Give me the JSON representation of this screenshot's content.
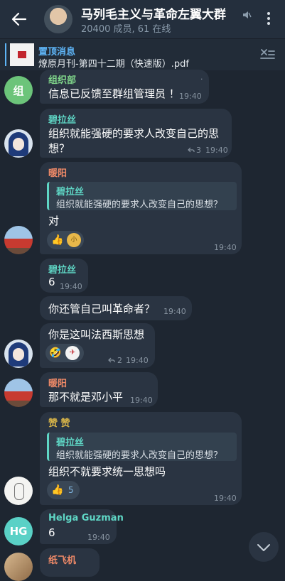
{
  "header": {
    "title": "马列毛主义与革命左翼大群",
    "subtitle": "20400 成员, 61 在线"
  },
  "pinned": {
    "title": "置顶消息",
    "text": "燎原月刊-第四十二期（快速版）.pdf"
  },
  "colors": {
    "accent": "#5eb5f7",
    "name_teal": "#5fd6c5",
    "name_orange": "#f08a68",
    "name_yellow": "#d6b349",
    "name_green": "#7fd48a"
  },
  "messages": [
    {
      "sender": "组织部",
      "avatar_text": "组",
      "text": "信息已反馈至群组管理员 ！",
      "time": "19:40",
      "mark": "."
    },
    {
      "sender": "碧拉丝",
      "lines": [
        "组织就能强硬的要求人改变自己的思",
        "想？"
      ],
      "time": "19:40",
      "replies": "3"
    },
    {
      "sender": "暖阳",
      "reply_name": "碧拉丝",
      "reply_text": "组织就能强硬的要求人改变自己的思想？",
      "text": "对",
      "time": "19:40"
    },
    {
      "sender": "碧拉丝",
      "text": "6",
      "time": "19:40"
    },
    {
      "text": "你还管自己叫革命者？",
      "time": "19:40"
    },
    {
      "text": "你是这叫法西斯思想",
      "time": "19:40",
      "replies": "2"
    },
    {
      "sender": "暖阳",
      "text": "那不就是邓小平",
      "time": "19:40"
    },
    {
      "sender": "赞 赞",
      "reply_name": "碧拉丝",
      "reply_text": "组织就能强硬的要求人改变自己的思想？",
      "text": "组织不就要求统一思想吗",
      "time": "19:40",
      "react_count": "5"
    },
    {
      "sender": "Helga Guzman",
      "avatar_text": "HG",
      "text": "6",
      "time": "19:40"
    },
    {
      "sender": "纸飞机"
    }
  ]
}
